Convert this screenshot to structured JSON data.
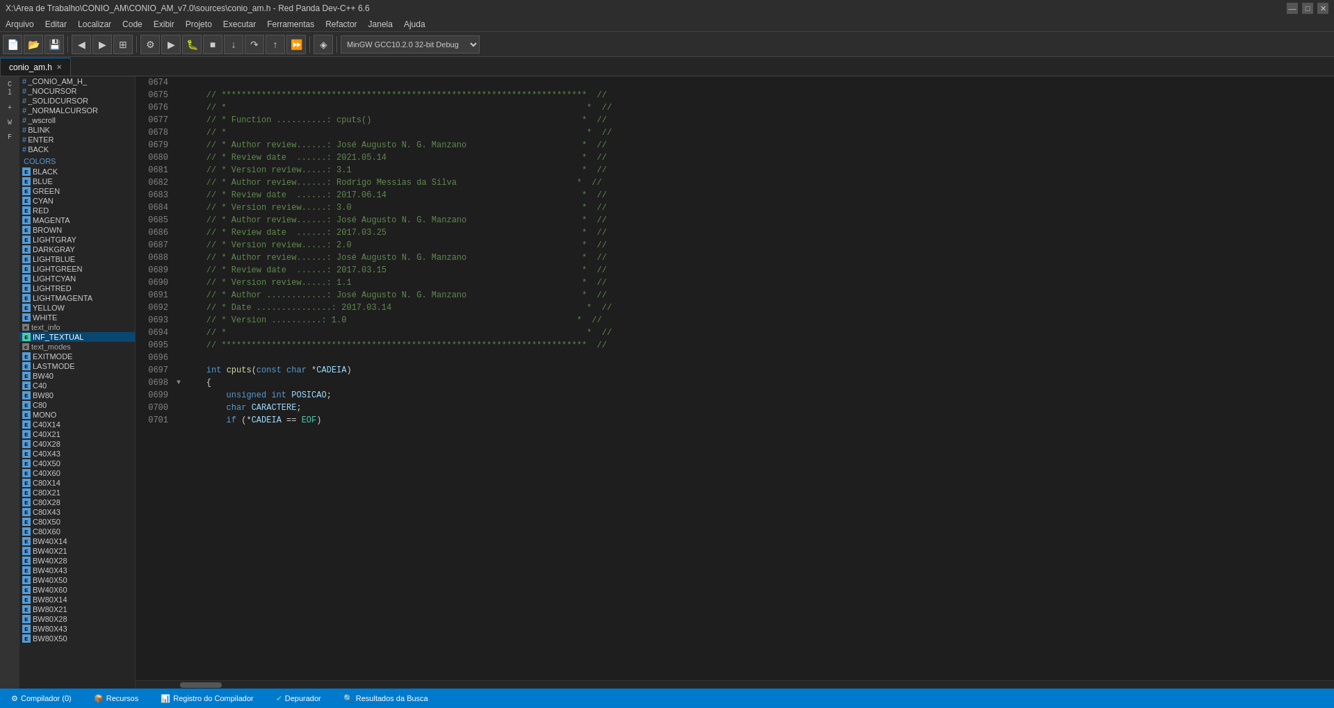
{
  "titlebar": {
    "title": "X:\\Area de Trabalho\\CONIO_AM\\CONIO_AM_v7.0\\sources\\conio_am.h - Red Panda Dev-C++ 6.6",
    "min": "—",
    "max": "□",
    "close": "✕"
  },
  "menubar": {
    "items": [
      "Arquivo",
      "Editar",
      "Localizar",
      "Code",
      "Exibir",
      "Projeto",
      "Executar",
      "Ferramentas",
      "Refactor",
      "Janela",
      "Ajuda"
    ]
  },
  "toolbar": {
    "compiler_label": "MinGW GCC10.2.0 32-bit Debug"
  },
  "tab": {
    "label": "conio_am.h",
    "close": "✕"
  },
  "sidebar": {
    "colors_header": "COLORS",
    "items": [
      {
        "label": "_CONIO_AM_H_",
        "type": "hash"
      },
      {
        "label": "_NOCURSOR",
        "type": "hash"
      },
      {
        "label": "_SOLIDCURSOR",
        "type": "hash"
      },
      {
        "label": "_NORMALCURSOR",
        "type": "hash"
      },
      {
        "label": "_wscroll",
        "type": "hash"
      },
      {
        "label": "BLINK",
        "type": "hash"
      },
      {
        "label": "ENTER",
        "type": "hash"
      },
      {
        "label": "BACK",
        "type": "hash"
      },
      {
        "label": "COLORS",
        "type": "section"
      },
      {
        "label": "BLACK",
        "type": "e"
      },
      {
        "label": "BLUE",
        "type": "e"
      },
      {
        "label": "GREEN",
        "type": "e"
      },
      {
        "label": "CYAN",
        "type": "e"
      },
      {
        "label": "RED",
        "type": "e"
      },
      {
        "label": "MAGENTA",
        "type": "e"
      },
      {
        "label": "BROWN",
        "type": "e"
      },
      {
        "label": "LIGHTGRAY",
        "type": "e"
      },
      {
        "label": "DARKGRAY",
        "type": "e"
      },
      {
        "label": "LIGHTBLUE",
        "type": "e"
      },
      {
        "label": "LIGHTGREEN",
        "type": "e"
      },
      {
        "label": "LIGHTCYAN",
        "type": "e"
      },
      {
        "label": "LIGHTRED",
        "type": "e"
      },
      {
        "label": "LIGHTMAGENTA",
        "type": "e"
      },
      {
        "label": "YELLOW",
        "type": "e"
      },
      {
        "label": "WHITE",
        "type": "e"
      },
      {
        "label": "text_info",
        "type": "e-small"
      },
      {
        "label": "INF_TEXTUAL",
        "type": "e-selected"
      },
      {
        "label": "text_modes",
        "type": "e-small"
      },
      {
        "label": "EXITMODE",
        "type": "e"
      },
      {
        "label": "LASTMODE",
        "type": "e"
      },
      {
        "label": "BW40",
        "type": "e"
      },
      {
        "label": "C40",
        "type": "e"
      },
      {
        "label": "BW80",
        "type": "e"
      },
      {
        "label": "C80",
        "type": "e"
      },
      {
        "label": "MONO",
        "type": "e"
      },
      {
        "label": "C40X14",
        "type": "e"
      },
      {
        "label": "C40X21",
        "type": "e"
      },
      {
        "label": "C40X28",
        "type": "e"
      },
      {
        "label": "C40X43",
        "type": "e"
      },
      {
        "label": "C40X50",
        "type": "e"
      },
      {
        "label": "C40X60",
        "type": "e"
      },
      {
        "label": "C80X14",
        "type": "e"
      },
      {
        "label": "C80X21",
        "type": "e"
      },
      {
        "label": "C80X28",
        "type": "e"
      },
      {
        "label": "C80X43",
        "type": "e"
      },
      {
        "label": "C80X50",
        "type": "e"
      },
      {
        "label": "C80X60",
        "type": "e"
      },
      {
        "label": "BW40X14",
        "type": "e"
      },
      {
        "label": "BW40X21",
        "type": "e"
      },
      {
        "label": "BW40X28",
        "type": "e"
      },
      {
        "label": "BW40X43",
        "type": "e"
      },
      {
        "label": "BW40X50",
        "type": "e"
      },
      {
        "label": "BW40X60",
        "type": "e"
      },
      {
        "label": "BW80X14",
        "type": "e"
      },
      {
        "label": "BW80X21",
        "type": "e"
      },
      {
        "label": "BW80X28",
        "type": "e"
      },
      {
        "label": "BW80X43",
        "type": "e"
      },
      {
        "label": "BW80X50",
        "type": "e"
      }
    ]
  },
  "code": {
    "lines": [
      {
        "num": "0674",
        "fold": "",
        "content": "",
        "parts": [
          {
            "text": "",
            "class": ""
          }
        ]
      },
      {
        "num": "0675",
        "fold": "",
        "content": "    // *************************************************************************  //",
        "parts": []
      },
      {
        "num": "0676",
        "fold": "",
        "content": "    // *                                                                        *  //",
        "parts": []
      },
      {
        "num": "0677",
        "fold": "",
        "content": "    // * Function ..........: cputs()                                          *  //",
        "parts": []
      },
      {
        "num": "0678",
        "fold": "",
        "content": "    // *                                                                        *  //",
        "parts": []
      },
      {
        "num": "0679",
        "fold": "",
        "content": "    // * Author review......: José Augusto N. G. Manzano                       *  //",
        "parts": []
      },
      {
        "num": "0680",
        "fold": "",
        "content": "    // * Review date  ......: 2021.05.14                                       *  //",
        "parts": []
      },
      {
        "num": "0681",
        "fold": "",
        "content": "    // * Version review.....: 3.1                                              *  //",
        "parts": []
      },
      {
        "num": "0682",
        "fold": "",
        "content": "    // * Author review......: Rodrigo Messias da Silva                        *  //",
        "parts": []
      },
      {
        "num": "0683",
        "fold": "",
        "content": "    // * Review date  ......: 2017.06.14                                       *  //",
        "parts": []
      },
      {
        "num": "0684",
        "fold": "",
        "content": "    // * Version review.....: 3.0                                              *  //",
        "parts": []
      },
      {
        "num": "0685",
        "fold": "",
        "content": "    // * Author review......: José Augusto N. G. Manzano                       *  //",
        "parts": []
      },
      {
        "num": "0686",
        "fold": "",
        "content": "    // * Review date  ......: 2017.03.25                                       *  //",
        "parts": []
      },
      {
        "num": "0687",
        "fold": "",
        "content": "    // * Version review.....: 2.0                                              *  //",
        "parts": []
      },
      {
        "num": "0688",
        "fold": "",
        "content": "    // * Author review......: José Augusto N. G. Manzano                       *  //",
        "parts": []
      },
      {
        "num": "0689",
        "fold": "",
        "content": "    // * Review date  ......: 2017.03.15                                       *  //",
        "parts": []
      },
      {
        "num": "0690",
        "fold": "",
        "content": "    // * Version review.....: 1.1                                              *  //",
        "parts": []
      },
      {
        "num": "0691",
        "fold": "",
        "content": "    // * Author ............: José Augusto N. G. Manzano                       *  //",
        "parts": []
      },
      {
        "num": "0692",
        "fold": "",
        "content": "    // * Date ...............: 2017.03.14                                       *  //",
        "parts": []
      },
      {
        "num": "0693",
        "fold": "",
        "content": "    // * Version ..........: 1.0                                              *  //",
        "parts": []
      },
      {
        "num": "0694",
        "fold": "",
        "content": "    // *                                                                        *  //",
        "parts": []
      },
      {
        "num": "0695",
        "fold": "",
        "content": "    // *************************************************************************  //",
        "parts": []
      },
      {
        "num": "0696",
        "fold": "",
        "content": "",
        "parts": []
      },
      {
        "num": "0697",
        "fold": "",
        "content": "    int cputs(const char *CADEIA)",
        "parts": [],
        "type": "func"
      },
      {
        "num": "0698",
        "fold": "▼",
        "content": "    {",
        "parts": []
      },
      {
        "num": "0699",
        "fold": "",
        "content": "        unsigned int POSICAO;",
        "parts": [],
        "type": "decl"
      },
      {
        "num": "0700",
        "fold": "",
        "content": "        char CARACTERE;",
        "parts": [],
        "type": "decl"
      },
      {
        "num": "0701",
        "fold": "",
        "content": "        if (*CADEIA == EOF)",
        "parts": [],
        "type": "stmt"
      }
    ]
  },
  "bottom_panel": {
    "tabs": [
      {
        "label": "Compilador (0)",
        "icon": "build"
      },
      {
        "label": "Recursos",
        "icon": "res"
      },
      {
        "label": "Registro do Compilador",
        "icon": "log"
      },
      {
        "label": "Depurador",
        "icon": "check"
      },
      {
        "label": "Resultados da Busca",
        "icon": "search"
      }
    ]
  }
}
